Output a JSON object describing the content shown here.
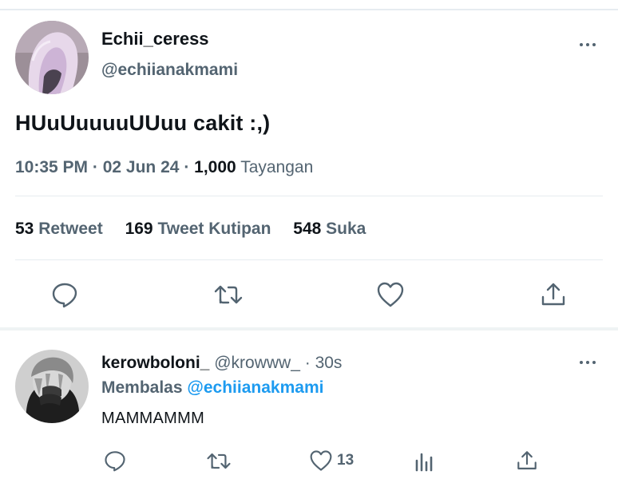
{
  "tweet": {
    "display_name": "Echii_ceress",
    "handle": "@echiianakmami",
    "text": "HUuUuuuuUUuu cakit :,)",
    "time": "10:35 PM",
    "separator": "·",
    "date": "02 Jun 24",
    "views_count": "1,000",
    "views_label": "Tayangan",
    "stats": {
      "retweets_count": "53",
      "retweets_label": "Retweet",
      "quotes_count": "169",
      "quotes_label": "Tweet Kutipan",
      "likes_count": "548",
      "likes_label": "Suka"
    },
    "actions": [
      "reply-icon",
      "retweet-icon",
      "like-icon",
      "share-icon"
    ]
  },
  "reply": {
    "display_name": "kerowboloni_",
    "handle": "@krowww_",
    "separator": "·",
    "age": "30s",
    "replying_prefix": "Membalas",
    "replying_to": "@echiianakmami",
    "text": "MAMMAMMM",
    "like_count": "13",
    "actions": [
      "reply-icon",
      "retweet-icon",
      "like-icon",
      "analytics-icon",
      "share-icon"
    ]
  },
  "colors": {
    "text_primary": "#0f1419",
    "text_secondary": "#536471",
    "accent": "#1d9bf0",
    "divider": "#e6ecf0"
  }
}
